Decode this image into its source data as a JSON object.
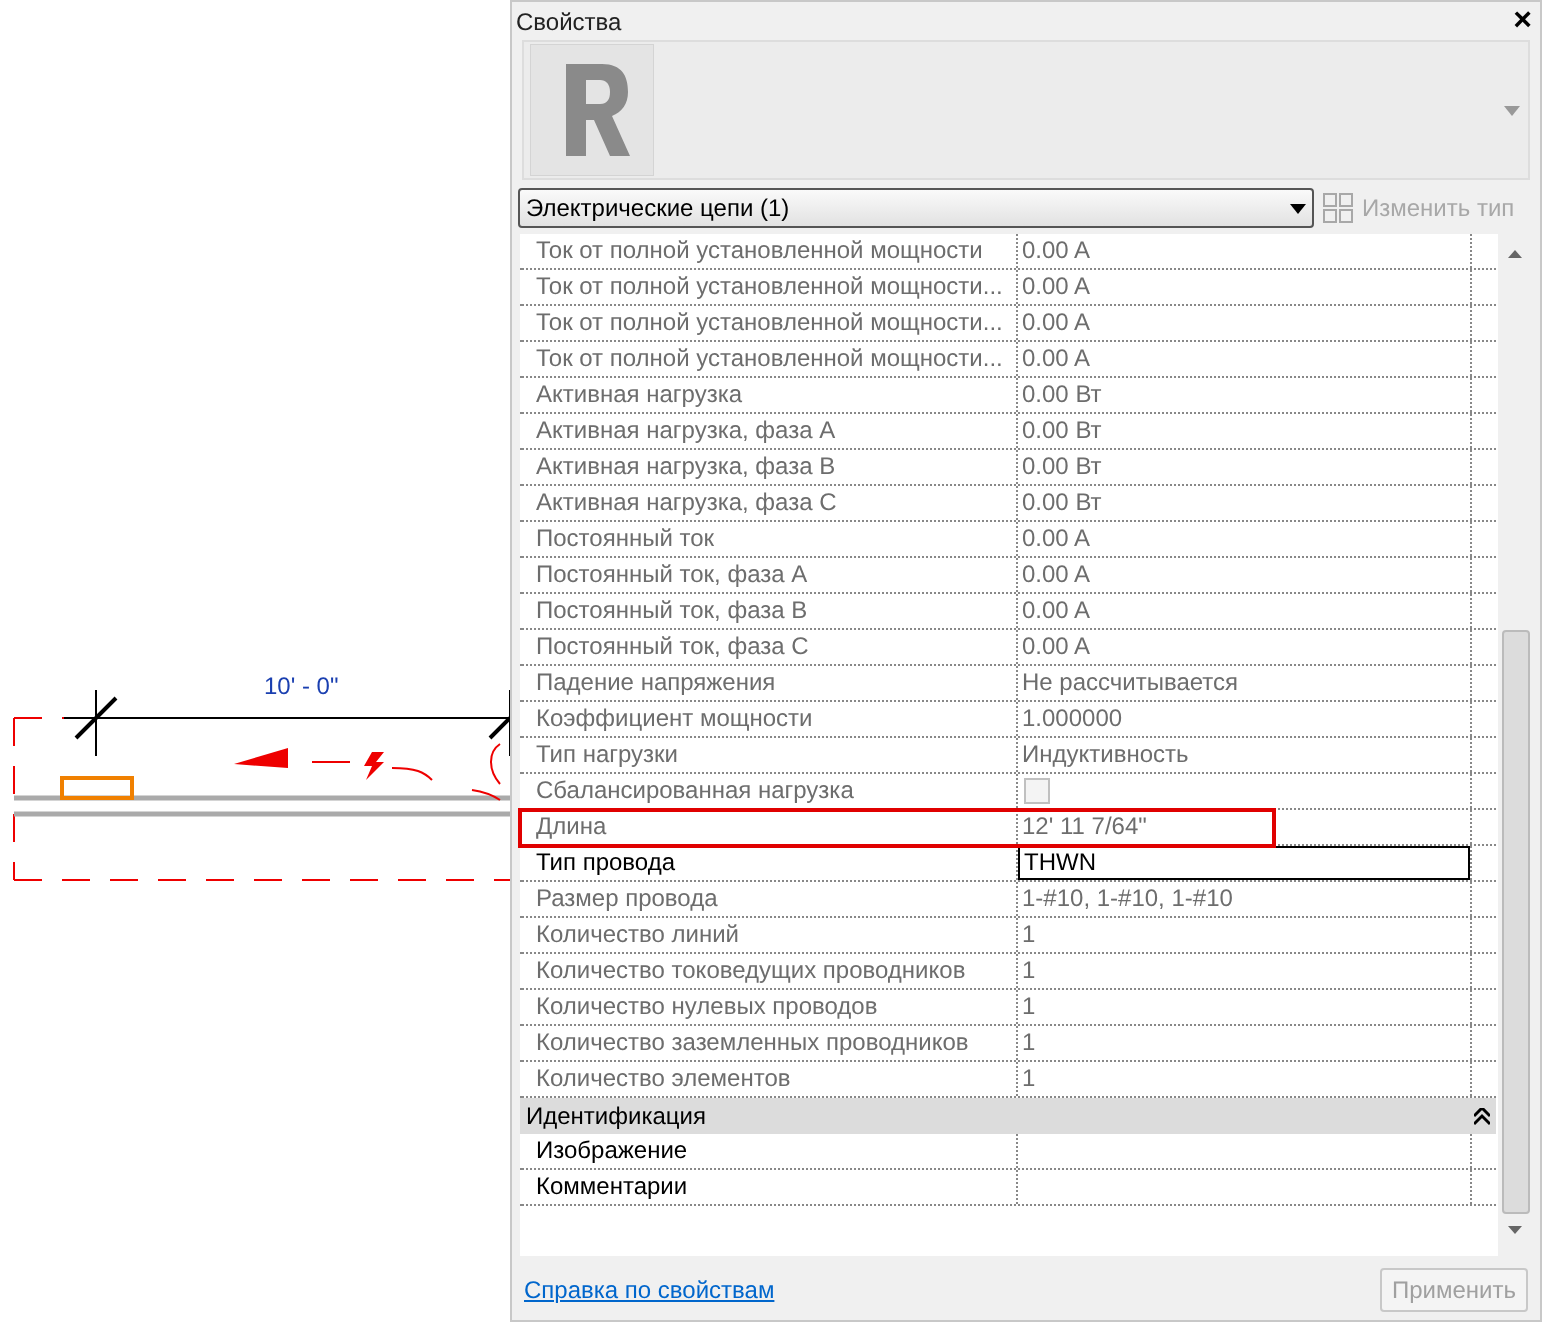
{
  "drawing": {
    "dimension": "10' - 0\""
  },
  "window": {
    "title": "Свойства",
    "close": "×"
  },
  "type_selector": {
    "value": "Электрические цепи (1)"
  },
  "edit_type_button": {
    "label": "Изменить тип",
    "disabled": true
  },
  "properties": [
    {
      "label": "Ток от полной установленной мощности",
      "value": "0.00 A",
      "kind": "text",
      "editable": false,
      "highlighted": false
    },
    {
      "label": "Ток от полной установленной мощности...",
      "value": "0.00 A",
      "kind": "text",
      "editable": false,
      "highlighted": false
    },
    {
      "label": "Ток от полной установленной мощности...",
      "value": "0.00 A",
      "kind": "text",
      "editable": false,
      "highlighted": false
    },
    {
      "label": "Ток от полной установленной мощности...",
      "value": "0.00 A",
      "kind": "text",
      "editable": false,
      "highlighted": false
    },
    {
      "label": "Активная нагрузка",
      "value": "0.00 Вт",
      "kind": "text",
      "editable": false,
      "highlighted": false
    },
    {
      "label": "Активная нагрузка, фаза A",
      "value": "0.00 Вт",
      "kind": "text",
      "editable": false,
      "highlighted": false
    },
    {
      "label": "Активная нагрузка, фаза B",
      "value": "0.00 Вт",
      "kind": "text",
      "editable": false,
      "highlighted": false
    },
    {
      "label": "Активная нагрузка, фаза C",
      "value": "0.00 Вт",
      "kind": "text",
      "editable": false,
      "highlighted": false
    },
    {
      "label": "Постоянный ток",
      "value": "0.00 A",
      "kind": "text",
      "editable": false,
      "highlighted": false
    },
    {
      "label": "Постоянный ток, фаза A",
      "value": "0.00 A",
      "kind": "text",
      "editable": false,
      "highlighted": false
    },
    {
      "label": "Постоянный ток, фаза B",
      "value": "0.00 A",
      "kind": "text",
      "editable": false,
      "highlighted": false
    },
    {
      "label": "Постоянный ток, фаза C",
      "value": "0.00 A",
      "kind": "text",
      "editable": false,
      "highlighted": false
    },
    {
      "label": "Падение напряжения",
      "value": "Не рассчитывается",
      "kind": "text",
      "editable": false,
      "highlighted": false
    },
    {
      "label": "Коэффициент мощности",
      "value": "1.000000",
      "kind": "text",
      "editable": false,
      "highlighted": false
    },
    {
      "label": "Тип нагрузки",
      "value": "Индуктивность",
      "kind": "text",
      "editable": false,
      "highlighted": false
    },
    {
      "label": "Сбалансированная нагрузка",
      "checked": false,
      "kind": "checkbox",
      "editable": false,
      "highlighted": false
    },
    {
      "label": "Длина",
      "value": "12'  11 7/64\"",
      "kind": "text",
      "editable": false,
      "highlighted": true
    },
    {
      "label": "Тип провода",
      "value": "THWN",
      "kind": "field",
      "editable": true,
      "highlighted": false
    },
    {
      "label": "Размер провода",
      "value": "1-#10, 1-#10, 1-#10",
      "kind": "text",
      "editable": false,
      "highlighted": false
    },
    {
      "label": "Количество линий",
      "value": "1",
      "kind": "text",
      "editable": false,
      "highlighted": false
    },
    {
      "label": "Количество токоведущих проводников",
      "value": "1",
      "kind": "text",
      "editable": false,
      "highlighted": false
    },
    {
      "label": "Количество нулевых проводов",
      "value": "1",
      "kind": "text",
      "editable": false,
      "highlighted": false
    },
    {
      "label": "Количество заземленных проводников",
      "value": "1",
      "kind": "text",
      "editable": false,
      "highlighted": false
    },
    {
      "label": "Количество элементов",
      "value": "1",
      "kind": "text",
      "editable": false,
      "highlighted": false
    }
  ],
  "sections": [
    {
      "title": "Идентификация",
      "expanded": true,
      "properties": [
        {
          "label": "Изображение",
          "editable": true,
          "highlighted": false
        },
        {
          "label": "Комментарии",
          "editable": true,
          "highlighted": false
        }
      ]
    }
  ],
  "help_link": "Справка по свойствам",
  "apply_button": {
    "label": "Применить",
    "disabled": true
  }
}
